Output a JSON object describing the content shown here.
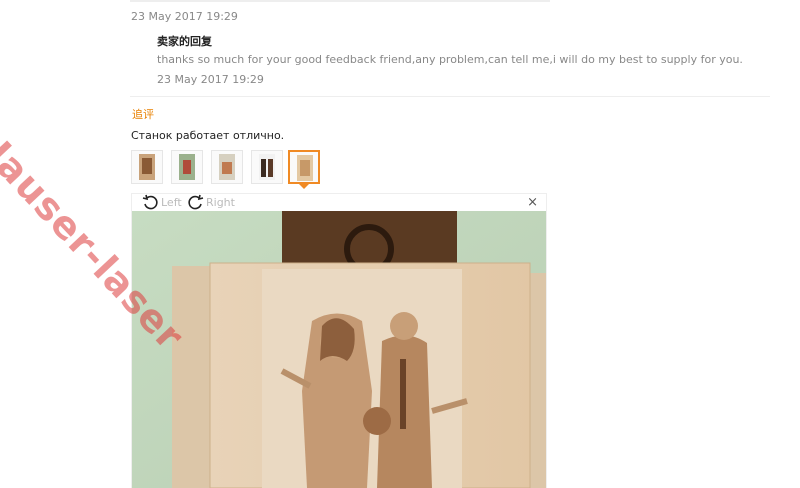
{
  "watermark": "Hauser-laser",
  "review": {
    "date": "23 May 2017 19:29",
    "seller_reply": {
      "label": "卖家的回复",
      "text": "thanks so much for your good feedback friend,any problem,can tell me,i will do my best to supply for you.",
      "date": "23 May 2017 19:29"
    },
    "followup": {
      "label": "追评",
      "text": "Станок работает отлично."
    },
    "thumbnails_count": 5,
    "active_thumbnail": 5
  },
  "viewer": {
    "rotate_left_label": "Left",
    "rotate_right_label": "Right",
    "close_label": "×"
  },
  "colors": {
    "accent": "#f08a24",
    "followup": "#e88000",
    "muted": "#888888"
  }
}
